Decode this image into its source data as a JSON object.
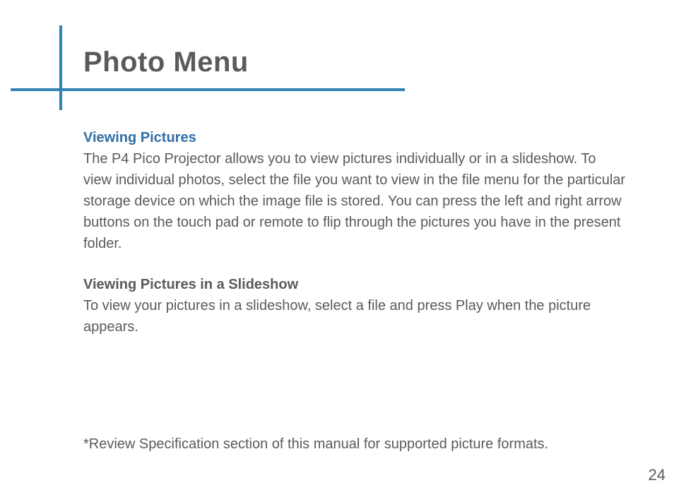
{
  "title": "Photo Menu",
  "section1": {
    "heading": "Viewing Pictures",
    "body": "The P4 Pico Projector allows you to view pictures individually or in a slideshow. To view individual photos, select the file you want to view in the file menu for the particular storage device on which the image file is stored.  You can press the left and right arrow buttons on the touch pad or remote to flip through the pictures you have in the present folder."
  },
  "section2": {
    "heading": "Viewing Pictures in a Slideshow",
    "body": "To view your pictures in a slideshow, select a file and press Play when the picture appears."
  },
  "footnote": "*Review Specification section of this manual for supported picture formats.",
  "page_number": "24"
}
